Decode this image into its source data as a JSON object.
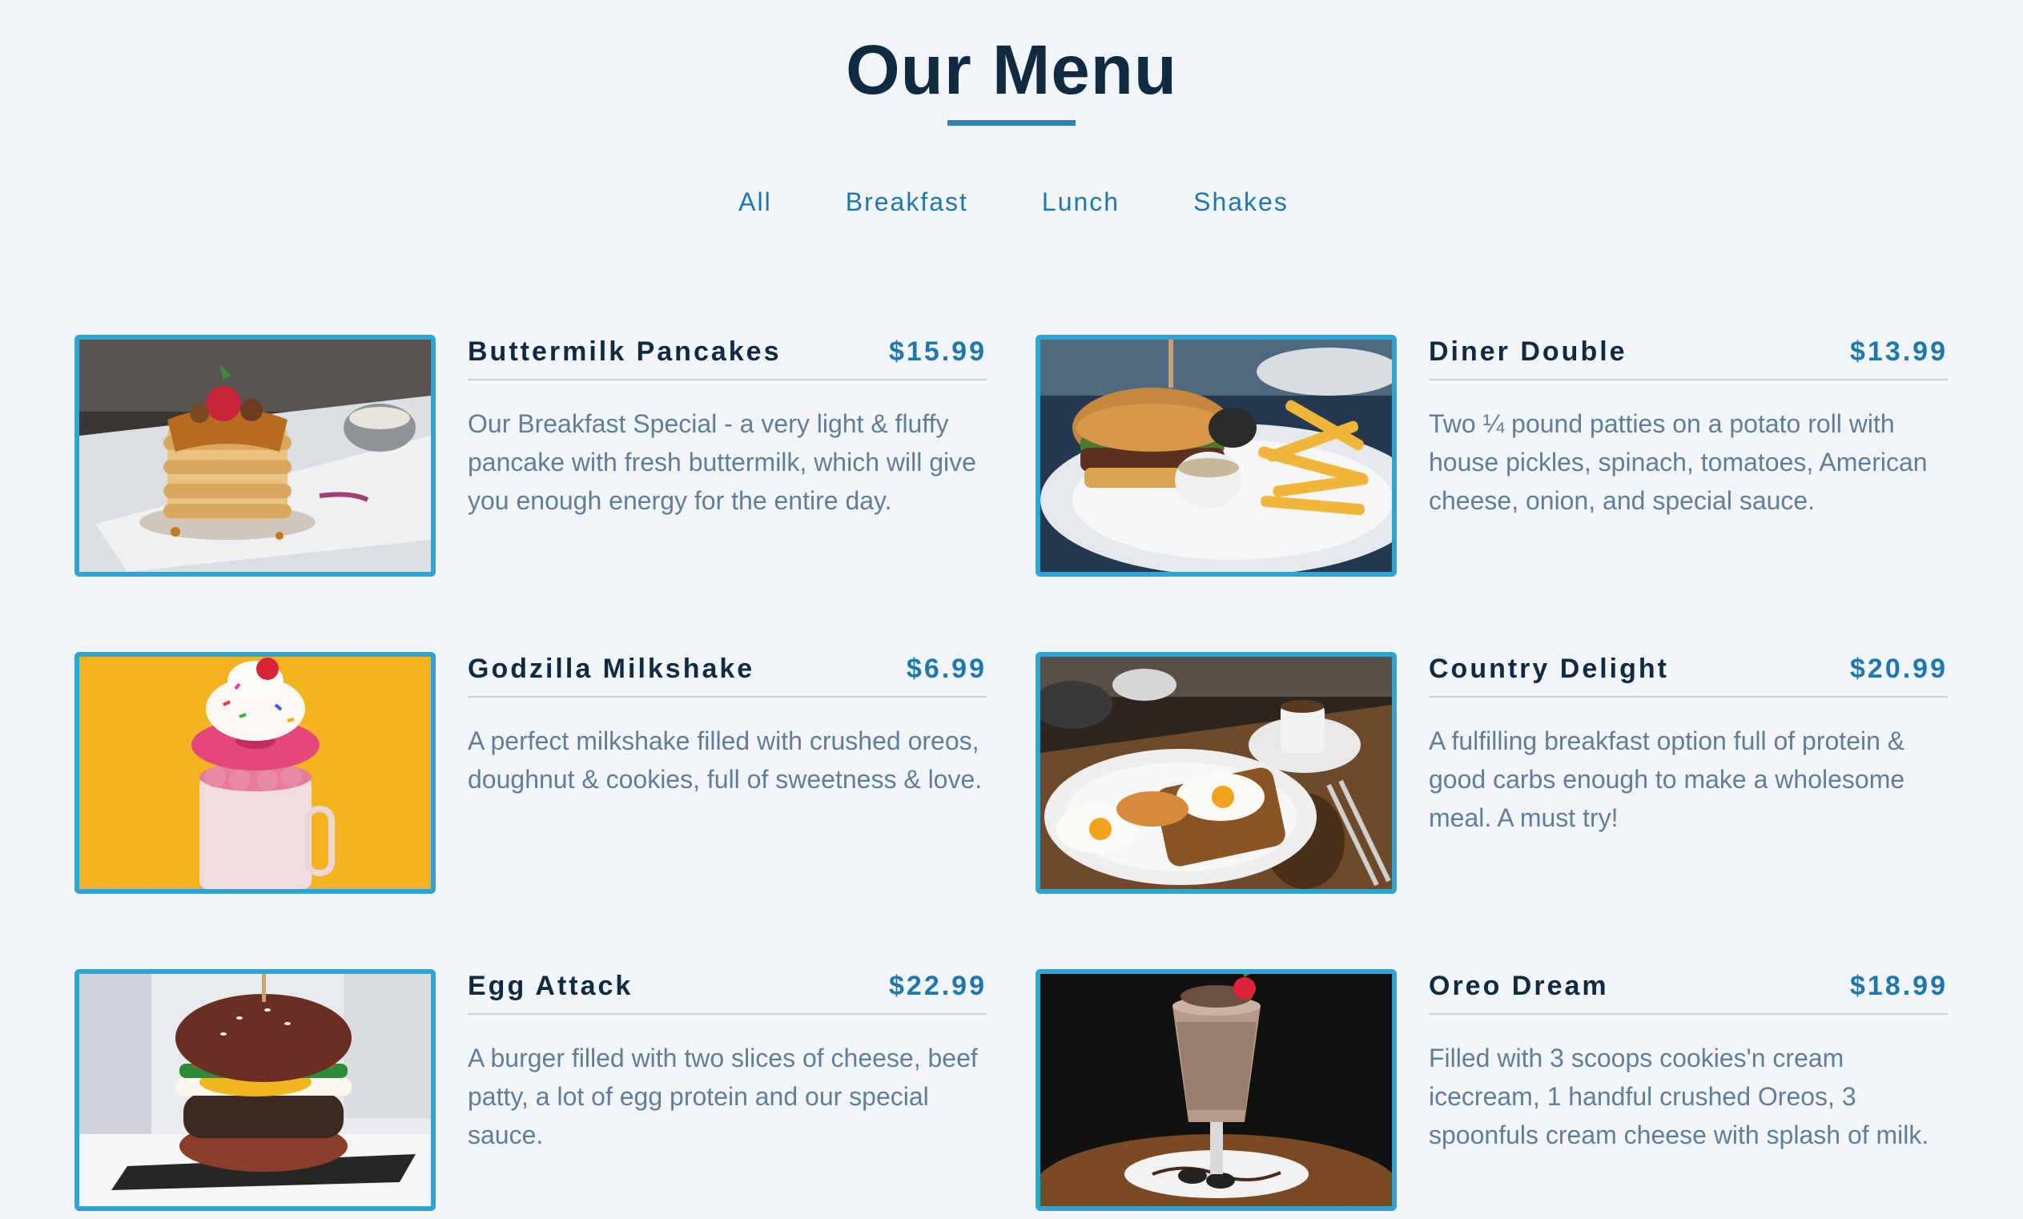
{
  "header": {
    "title": "Our Menu"
  },
  "filters": [
    {
      "label": "All"
    },
    {
      "label": "Breakfast"
    },
    {
      "label": "Lunch"
    },
    {
      "label": "Shakes"
    }
  ],
  "items": [
    {
      "name": "Buttermilk Pancakes",
      "price": "$15.99",
      "desc": "Our Breakfast Special - a very light & fluffy pancake with fresh buttermilk, which will give you enough energy for the entire day.",
      "image": "pancakes-photo"
    },
    {
      "name": "Diner Double",
      "price": "$13.99",
      "desc": "Two ¼ pound patties on a potato roll with house pickles, spinach, tomatoes, American cheese, onion, and special sauce.",
      "image": "burger-fries-photo"
    },
    {
      "name": "Godzilla Milkshake",
      "price": "$6.99",
      "desc": "A perfect milkshake filled with crushed oreos, doughnut & cookies, full of sweetness & love.",
      "image": "milkshake-photo"
    },
    {
      "name": "Country Delight",
      "price": "$20.99",
      "desc": "A fulfilling breakfast option full of protein & good carbs enough to make a wholesome meal. A must try!",
      "image": "breakfast-plate-photo"
    },
    {
      "name": "Egg Attack",
      "price": "$22.99",
      "desc": "A burger filled with two slices of cheese, beef patty, a lot of egg protein and our special sauce.",
      "image": "egg-burger-photo"
    },
    {
      "name": "Oreo Dream",
      "price": "$18.99",
      "desc": "Filled with 3 scoops cookies'n cream icecream, 1 handful crushed Oreos, 3 spoonfuls cream cheese with splash of milk.",
      "image": "oreo-shake-photo"
    }
  ],
  "colors": {
    "background": "#f1f5f8",
    "title": "#102a42",
    "accent": "#1f78ad",
    "photo_border": "#2aa5d6",
    "description": "#617d98"
  }
}
